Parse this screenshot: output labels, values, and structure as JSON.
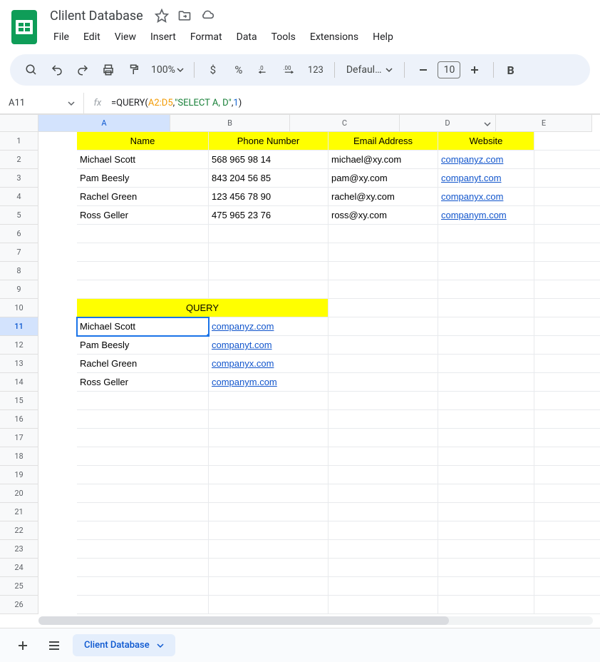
{
  "doc_title": "Clilent Database",
  "menu": [
    "File",
    "Edit",
    "View",
    "Insert",
    "Format",
    "Data",
    "Tools",
    "Extensions",
    "Help"
  ],
  "toolbar": {
    "zoom": "100%",
    "format_123": "123",
    "font": "Defaul…",
    "font_size": "10"
  },
  "name_box": "A11",
  "formula": {
    "prefix": "=QUERY(",
    "range": "A2:D5",
    "comma1": ", ",
    "str": "\"SELECT A, D\"",
    "comma2": ", ",
    "num": "1",
    "suffix": ")"
  },
  "columns": [
    "A",
    "B",
    "C",
    "D",
    "E"
  ],
  "rows": [
    "1",
    "2",
    "3",
    "4",
    "5",
    "6",
    "7",
    "8",
    "9",
    "10",
    "11",
    "12",
    "13",
    "14",
    "15",
    "16",
    "17",
    "18",
    "19",
    "20",
    "21",
    "22",
    "23",
    "24",
    "25",
    "26"
  ],
  "headers": {
    "A1": "Name",
    "B1": "Phone Number",
    "C1": "Email Address",
    "D1": "Website"
  },
  "data_rows": [
    {
      "name": "Michael Scott",
      "phone": "568 965 98 14",
      "email": "michael@xy.com",
      "web": "companyz.com"
    },
    {
      "name": "Pam Beesly",
      "phone": "843 204 56 85",
      "email": "pam@xy.com",
      "web": "companyt.com"
    },
    {
      "name": "Rachel Green",
      "phone": "123 456 78 90",
      "email": "rachel@xy.com",
      "web": "companyx.com"
    },
    {
      "name": "Ross Geller",
      "phone": "475 965 23 76",
      "email": "ross@xy.com",
      "web": "companym.com"
    }
  ],
  "query_header": "QUERY",
  "query_rows": [
    {
      "name": "Michael Scott",
      "web": "companyz.com"
    },
    {
      "name": "Pam Beesly",
      "web": "companyt.com"
    },
    {
      "name": "Rachel Green",
      "web": "companyx.com"
    },
    {
      "name": "Ross Geller",
      "web": "companym.com"
    }
  ],
  "sheet_tab": "Client Database"
}
